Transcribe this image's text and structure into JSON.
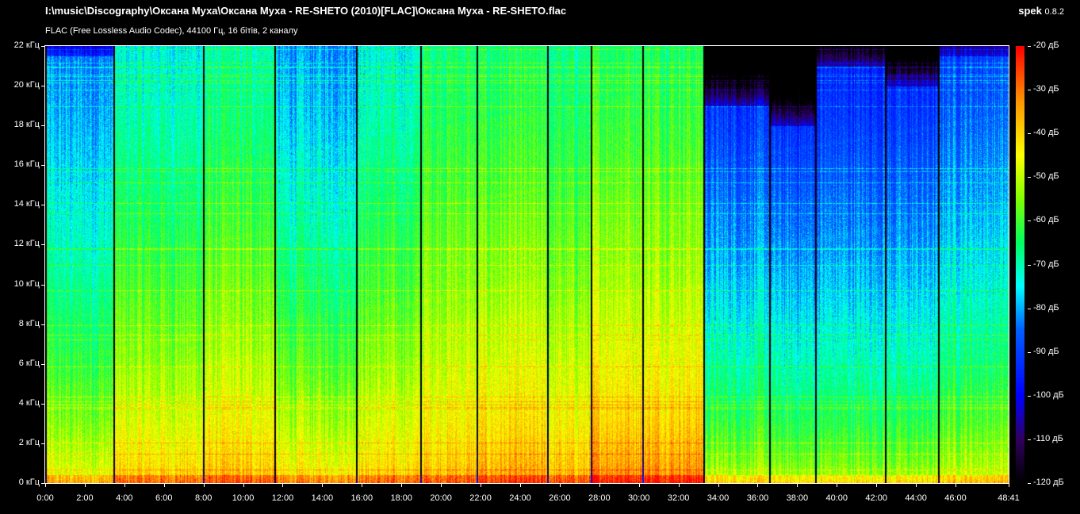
{
  "header": {
    "file_path": "I:\\music\\Discography\\Оксана Муха\\Оксана Муха - RE-SHETO (2010)[FLAC]\\Оксана Муха - RE-SHETO.flac",
    "audio_info": "FLAC (Free Lossless Audio Codec), 44100 Гц, 16 бітів, 2 каналу",
    "app_name": "spek",
    "app_version": "0.8.2"
  },
  "chart_data": {
    "type": "heatmap",
    "title": "Spectrogram",
    "duration": "48:41",
    "duration_seconds": 2921,
    "y_axis": {
      "unit": "кГц",
      "range": [
        0,
        22
      ],
      "ticks": [
        "0 кГц",
        "2 кГц",
        "4 кГц",
        "6 кГц",
        "8 кГц",
        "10 кГц",
        "12 кГц",
        "14 кГц",
        "16 кГц",
        "18 кГц",
        "20 кГц",
        "22 кГц"
      ]
    },
    "x_axis": {
      "ticks": [
        "0:00",
        "2:00",
        "4:00",
        "6:00",
        "8:00",
        "10:00",
        "12:00",
        "14:00",
        "16:00",
        "18:00",
        "20:00",
        "22:00",
        "24:00",
        "26:00",
        "28:00",
        "30:00",
        "32:00",
        "34:00",
        "36:00",
        "38:00",
        "40:00",
        "42:00",
        "44:00",
        "46:00",
        "48:41"
      ]
    },
    "color_scale": {
      "unit": "дБ",
      "range": [
        -120,
        -20
      ],
      "ticks": [
        "-20 дБ",
        "-30 дБ",
        "-40 дБ",
        "-50 дБ",
        "-60 дБ",
        "-70 дБ",
        "-80 дБ",
        "-90 дБ",
        "-100 дБ",
        "-110 дБ",
        "-120 дБ"
      ]
    },
    "palette": [
      "#000000",
      "#300060",
      "#0000ff",
      "#0060ff",
      "#00ffff",
      "#00ff60",
      "#80ff00",
      "#ffff00",
      "#ff9900",
      "#ff0000"
    ]
  }
}
